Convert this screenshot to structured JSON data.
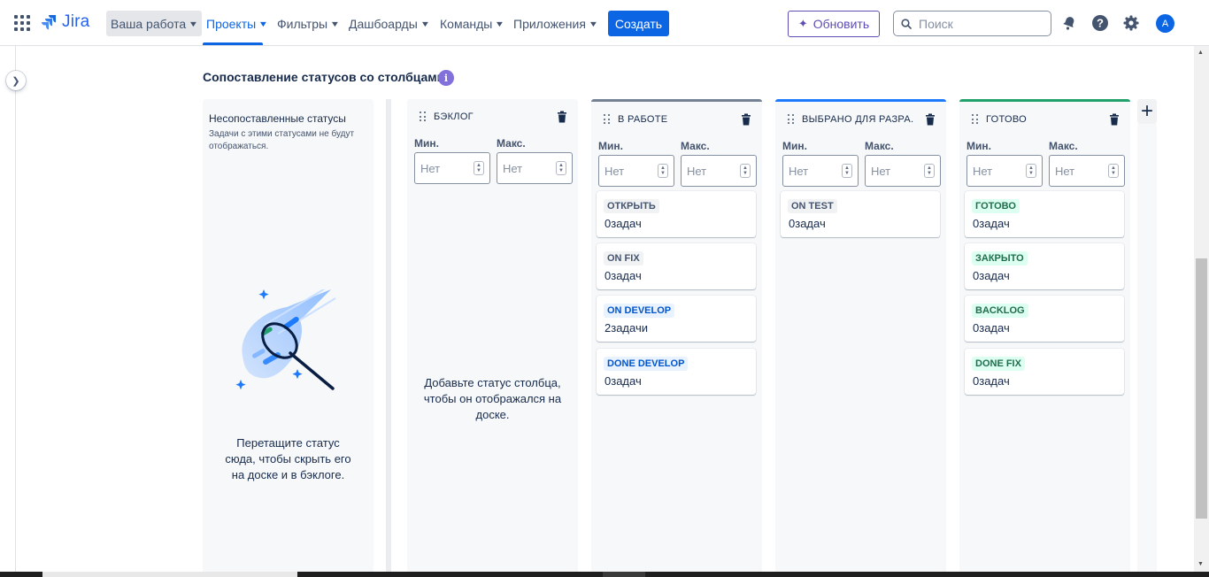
{
  "nav": {
    "logo_text": "Jira",
    "items": [
      {
        "label": "Ваша работа"
      },
      {
        "label": "Проекты"
      },
      {
        "label": "Фильтры"
      },
      {
        "label": "Дашбоарды"
      },
      {
        "label": "Команды"
      },
      {
        "label": "Приложения"
      }
    ],
    "create_label": "Создать",
    "update_label": "Обновить",
    "search_placeholder": "Поиск",
    "avatar_initial": "A",
    "accent_color": "#0c66e4"
  },
  "section": {
    "title": "Сопоставление статусов со столбцами",
    "info_glyph": "i"
  },
  "unmapped": {
    "title": "Несопоставленные статусы",
    "description": "Задачи с этими статусами не будут отображаться.",
    "drop_hint": "Перетащите статус сюда, чтобы скрыть его на доске и в бэклоге."
  },
  "columns": [
    {
      "name": "БЭКЛОГ",
      "min_label": "Мин.",
      "max_label": "Макс.",
      "min_placeholder": "Нет",
      "max_placeholder": "Нет",
      "empty_hint": "Добавьте статус столбца, чтобы он отображался на доске."
    },
    {
      "name": "В РАБОТЕ",
      "min_label": "Мин.",
      "max_label": "Макс.",
      "min_placeholder": "Нет",
      "max_placeholder": "Нет",
      "statuses": [
        {
          "name": "ОТКРЫТЬ",
          "count": "0задач"
        },
        {
          "name": "ON FIX",
          "count": "0задач"
        },
        {
          "name": "ON DEVELOP",
          "count": "2задачи"
        },
        {
          "name": "DONE DEVELOP",
          "count": "0задач"
        }
      ]
    },
    {
      "name": "ВЫБРАНО ДЛЯ РАЗРА...",
      "min_label": "Мин.",
      "max_label": "Макс.",
      "min_placeholder": "Нет",
      "max_placeholder": "Нет",
      "statuses": [
        {
          "name": "ON TEST",
          "count": "0задач"
        }
      ]
    },
    {
      "name": "ГОТОВО",
      "min_label": "Мин.",
      "max_label": "Макс.",
      "min_placeholder": "Нет",
      "max_placeholder": "Нет",
      "statuses": [
        {
          "name": "ГОТОВО",
          "count": "0задач"
        },
        {
          "name": "ЗАКРЫТО",
          "count": "0задач"
        },
        {
          "name": "BACKLOG",
          "count": "0задач"
        },
        {
          "name": "DONE FIX",
          "count": "0задач"
        }
      ]
    }
  ],
  "add_column_glyph": "+"
}
